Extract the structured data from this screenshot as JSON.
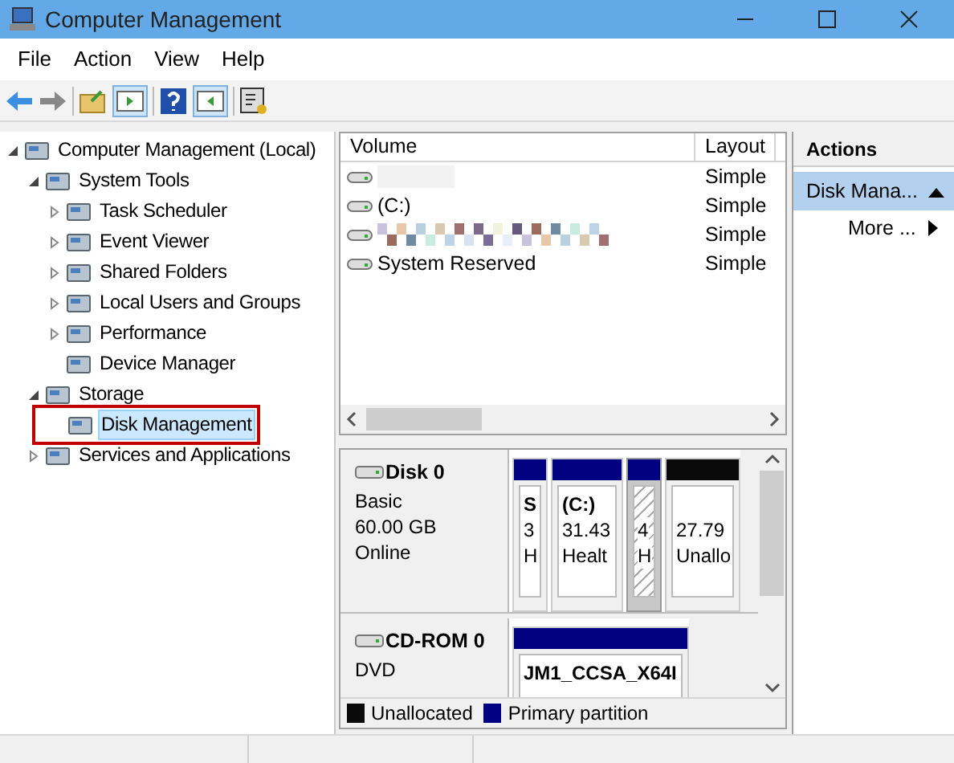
{
  "window": {
    "title": "Computer Management"
  },
  "menu": [
    {
      "label": "File"
    },
    {
      "label": "Action"
    },
    {
      "label": "View"
    },
    {
      "label": "Help"
    }
  ],
  "tree": [
    {
      "label": "Computer Management (Local)",
      "selected": false,
      "highlighted": false,
      "expanded": true,
      "children": [
        {
          "label": "System Tools",
          "selected": false,
          "highlighted": false,
          "expanded": true,
          "children": [
            {
              "label": "Task Scheduler",
              "selected": false,
              "highlighted": false,
              "expanded": false
            },
            {
              "label": "Event Viewer",
              "selected": false,
              "highlighted": false,
              "expanded": false
            },
            {
              "label": "Shared Folders",
              "selected": false,
              "highlighted": false,
              "expanded": false
            },
            {
              "label": "Local Users and Groups",
              "selected": false,
              "highlighted": false,
              "expanded": false
            },
            {
              "label": "Performance",
              "selected": false,
              "highlighted": false,
              "expanded": false
            },
            {
              "label": "Device Manager",
              "selected": false,
              "highlighted": false
            }
          ]
        },
        {
          "label": "Storage",
          "selected": false,
          "highlighted": false,
          "expanded": true,
          "children": [
            {
              "label": "Disk Management",
              "selected": true,
              "highlighted": true
            }
          ]
        },
        {
          "label": "Services and Applications",
          "selected": false,
          "highlighted": false,
          "expanded": false
        }
      ]
    }
  ],
  "volumes": {
    "columns": [
      "Volume",
      "Layout"
    ],
    "rows": [
      {
        "redacted": true,
        "layout": "Simple"
      },
      {
        "redacted": false,
        "name": "(C:)",
        "layout": "Simple"
      },
      {
        "redacted": true,
        "layout": "Simple"
      },
      {
        "redacted": false,
        "name": "System Reserved",
        "layout": "Simple"
      }
    ]
  },
  "disks": [
    {
      "name": "Disk 0",
      "lines": [
        "Basic",
        "60.00 GB",
        "Online"
      ],
      "partitions": [
        {
          "color": "#000080",
          "selected": false,
          "label": "S",
          "size": "3",
          "status": "H"
        },
        {
          "color": "#000080",
          "selected": false,
          "label": "(C:)",
          "size": "31.43",
          "status": "Healt"
        },
        {
          "color": "#000080",
          "selected": true,
          "size": "4",
          "status": "H"
        },
        {
          "color": "#0a0a0a",
          "selected": false,
          "size": "27.79",
          "status": "Unallo"
        }
      ]
    },
    {
      "name": "CD-ROM 0",
      "lines": [
        "DVD"
      ],
      "partitions": [
        {
          "color": "#000080",
          "selected": false,
          "label": "JM1_CCSA_X64I"
        }
      ]
    }
  ],
  "legend": [
    {
      "label": "Unallocated",
      "color": "#0a0a0a"
    },
    {
      "label": "Primary partition",
      "color": "#000080"
    }
  ],
  "actions": {
    "title": "Actions",
    "items": [
      {
        "kind": "header",
        "label": "Disk Mana..."
      },
      {
        "kind": "link",
        "label": "More ..."
      }
    ]
  }
}
